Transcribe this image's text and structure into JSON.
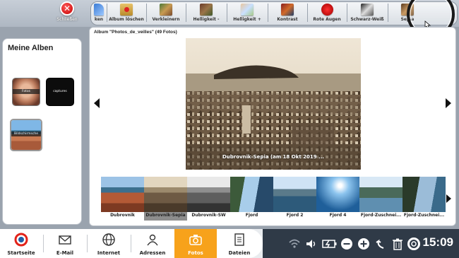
{
  "toolbar": {
    "close_label": "Schließen",
    "tools": [
      {
        "label": "ken",
        "icon": "undo-icon"
      },
      {
        "label": "Album löschen",
        "icon": "delete-album-icon"
      },
      {
        "label": "Verkleinern",
        "icon": "shrink-icon"
      },
      {
        "label": "Helligkeit -",
        "icon": "brightness-down-icon"
      },
      {
        "label": "Helligkeit +",
        "icon": "brightness-up-icon"
      },
      {
        "label": "Kontrast",
        "icon": "contrast-icon"
      },
      {
        "label": "Rote Augen",
        "icon": "red-eye-icon"
      },
      {
        "label": "Schwarz-Weiß",
        "icon": "black-white-icon"
      },
      {
        "label": "Sepia",
        "icon": "sepia-icon"
      }
    ]
  },
  "albums": {
    "title": "Meine Alben",
    "items": [
      {
        "label": "Fotos"
      },
      {
        "label": "captures"
      },
      {
        "label": "Bildschirmsche"
      }
    ]
  },
  "viewer": {
    "album_title": "Album \"Photos_de_veilles\" (49 Fotos)",
    "photo_caption": "Dubrovnik-Sepia (am 18 Okt 2019 ...",
    "filmstrip": [
      {
        "label": "Dubrovnik"
      },
      {
        "label": "Dubrovnik-Sepia"
      },
      {
        "label": "Dubrovnik-SW"
      },
      {
        "label": "Fjord"
      },
      {
        "label": "Fjord 2"
      },
      {
        "label": "Fjord 4"
      },
      {
        "label": "Fjord-Zuschnei..."
      },
      {
        "label": "Fjord-Zuschnei..."
      }
    ]
  },
  "taskbar": {
    "items": [
      {
        "label": "Startseite"
      },
      {
        "label": "E-Mail"
      },
      {
        "label": "Internet"
      },
      {
        "label": "Adressen"
      },
      {
        "label": "Fotos"
      },
      {
        "label": "Dateien"
      }
    ],
    "clock": "15:09"
  },
  "colors": {
    "active_tab": "#f7a21b",
    "system_bar": "#2f3a47",
    "close_red": "#d10000"
  }
}
